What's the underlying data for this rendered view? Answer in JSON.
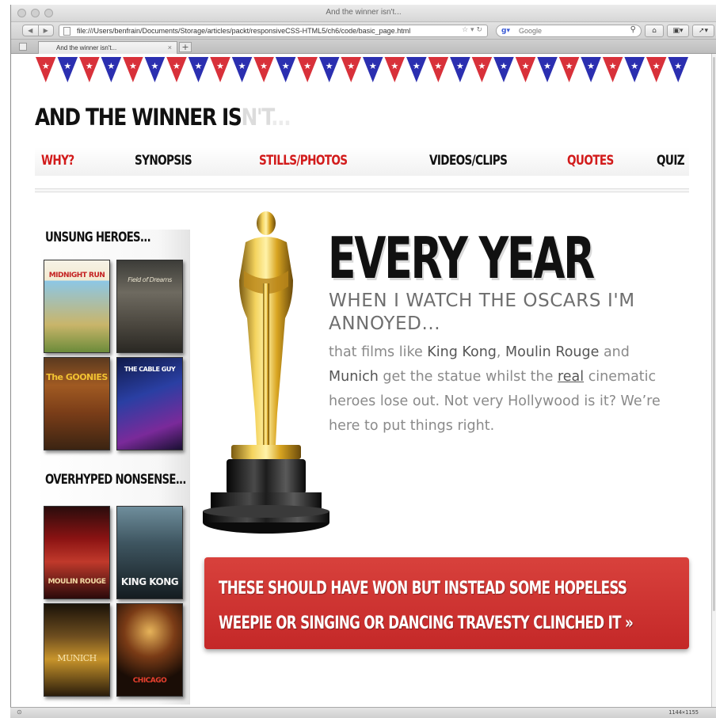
{
  "window": {
    "title": "And the winner isn't...",
    "url": "file:///Users/benfrain/Documents/Storage/articles/packt/responsiveCSS-HTML5/ch6/code/basic_page.html",
    "search_placeholder": "Google",
    "tab_label": "And the winner isn't...",
    "new_tab_label": "+",
    "status_size": "1144×1155"
  },
  "site": {
    "title_main": "AND THE WINNER IS",
    "title_fade": "N'T",
    "title_dots": "..."
  },
  "nav": {
    "items": [
      {
        "label": "WHY?",
        "color": "#d21b1b"
      },
      {
        "label": "SYNOPSIS",
        "color": "#111111"
      },
      {
        "label": "STILLS/PHOTOS",
        "color": "#d21b1b"
      },
      {
        "label": "VIDEOS/CLIPS",
        "color": "#111111"
      },
      {
        "label": "QUOTES",
        "color": "#d21b1b"
      },
      {
        "label": "QUIZ",
        "color": "#111111"
      }
    ]
  },
  "sidebar": {
    "heading_1": "UNSUNG HEROES...",
    "heading_2": "OVERHYPED NONSENSE...",
    "unsung": [
      {
        "title": "MIDNIGHT RUN"
      },
      {
        "title": "Field of Dreams"
      },
      {
        "title": "The GOONIES"
      },
      {
        "title": "THE CABLE GUY"
      }
    ],
    "overhyped": [
      {
        "title": "MOULIN ROUGE"
      },
      {
        "title": "KING KONG"
      },
      {
        "title": "MUNICH"
      },
      {
        "title": "CHICAGO"
      }
    ]
  },
  "hero": {
    "headline": "EVERY YEAR",
    "subhead": "WHEN I WATCH THE OSCARS I'M ANNOYED...",
    "body_1": "that films like ",
    "film_1": "King Kong",
    "body_2": ", ",
    "film_2": "Moulin Rouge",
    "body_3": " and ",
    "film_3": "Munich",
    "body_4": " get the statue whilst the ",
    "body_real": "real",
    "body_5": " cinematic heroes lose out. Not very Hollywood is it? We’re here to put things right."
  },
  "cta": {
    "label": "THESE SHOULD HAVE WON BUT INSTEAD SOME HOPELESS WEEPIE OR SINGING OR DANCING TRAVESTY CLINCHED IT »"
  },
  "colors": {
    "accent_red": "#d21b1b",
    "bunting_red": "#d8313a",
    "bunting_blue": "#2b2fb0",
    "cta_red": "#c9302c"
  },
  "icons": [
    "back-icon",
    "forward-icon",
    "page-icon",
    "search-icon",
    "home-icon",
    "bookmark-icon",
    "tools-icon",
    "star-icon",
    "reload-icon",
    "oscar-statue-image"
  ]
}
